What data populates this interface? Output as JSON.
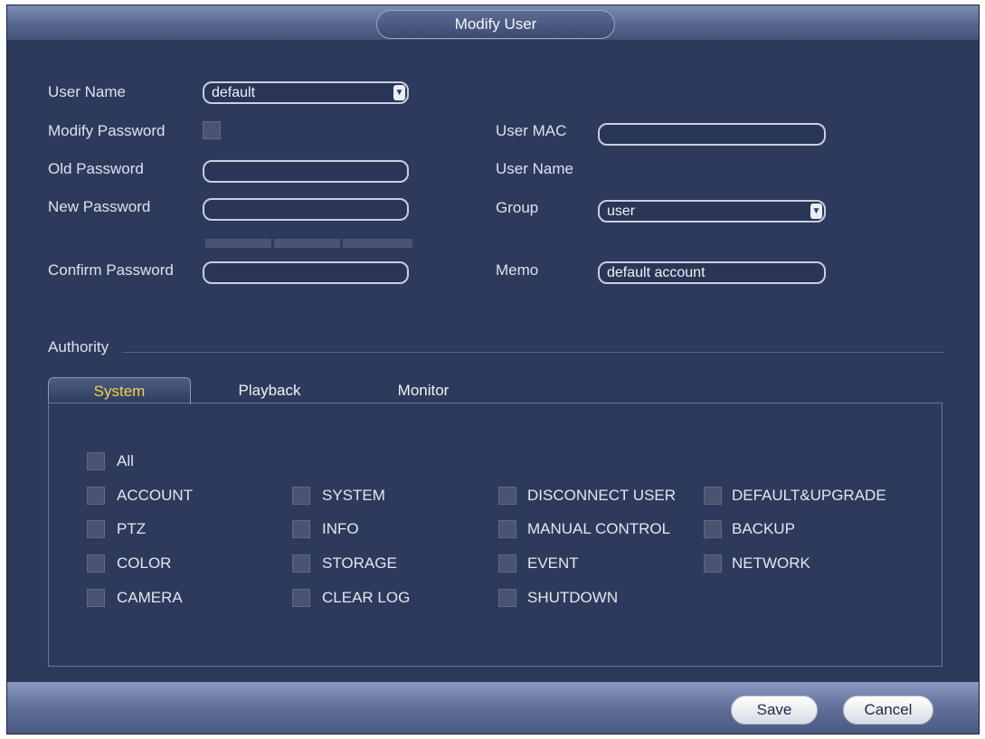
{
  "title": "Modify User",
  "form": {
    "user_name_label": "User Name",
    "user_name_value": "default",
    "modify_password_label": "Modify Password",
    "old_password_label": "Old Password",
    "new_password_label": "New Password",
    "confirm_password_label": "Confirm Password",
    "user_mac_label": "User MAC",
    "right_user_name_label": "User Name",
    "group_label": "Group",
    "group_value": "user",
    "memo_label": "Memo",
    "memo_value": "default account"
  },
  "authority": {
    "label": "Authority",
    "tabs": [
      "System",
      "Playback",
      "Monitor"
    ],
    "active_tab": "System",
    "all_label": "All",
    "col1": [
      "ACCOUNT",
      "PTZ",
      "COLOR",
      "CAMERA"
    ],
    "col2": [
      "SYSTEM",
      "INFO",
      "STORAGE",
      "CLEAR LOG"
    ],
    "col3": [
      "DISCONNECT USER",
      "MANUAL CONTROL",
      "EVENT",
      "SHUTDOWN"
    ],
    "col4": [
      "DEFAULT&UPGRADE",
      "BACKUP",
      "NETWORK"
    ]
  },
  "buttons": {
    "save": "Save",
    "cancel": "Cancel"
  },
  "colors": {
    "background": "#2d3a5b",
    "accent_tab": "#f0d24a"
  }
}
